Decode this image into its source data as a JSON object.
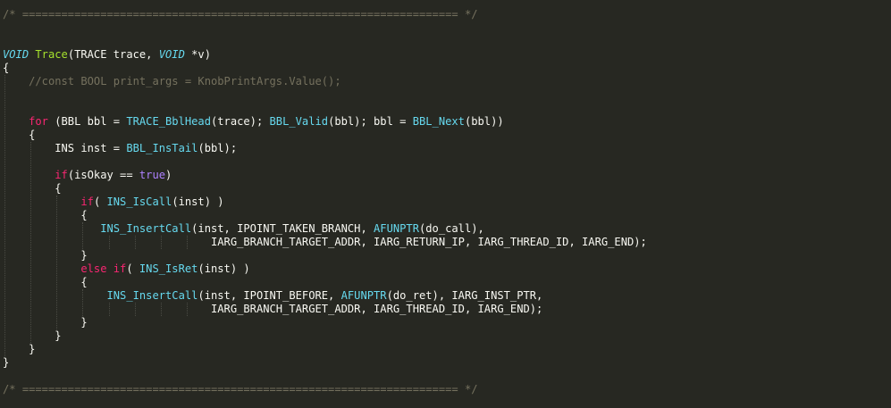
{
  "lines": [
    {
      "row": 0,
      "tokens": [
        {
          "t": "/* =================================================================== */",
          "c": "comment"
        }
      ]
    },
    {
      "row": 3,
      "tokens": [
        {
          "t": "VOID",
          "c": "type"
        },
        {
          "t": " ",
          "c": "plain"
        },
        {
          "t": "Trace",
          "c": "func"
        },
        {
          "t": "(TRACE trace, ",
          "c": "plain"
        },
        {
          "t": "VOID",
          "c": "type"
        },
        {
          "t": " *v)",
          "c": "plain"
        }
      ]
    },
    {
      "row": 4,
      "tokens": [
        {
          "t": "{",
          "c": "plain"
        }
      ]
    },
    {
      "row": 5,
      "tokens": [
        {
          "t": "    //const BOOL print_args = KnobPrintArgs.Value();",
          "c": "comment"
        }
      ]
    },
    {
      "row": 8,
      "tokens": [
        {
          "t": "    ",
          "c": "plain"
        },
        {
          "t": "for",
          "c": "kw"
        },
        {
          "t": " (BBL bbl = ",
          "c": "plain"
        },
        {
          "t": "TRACE_BblHead",
          "c": "api"
        },
        {
          "t": "(trace); ",
          "c": "plain"
        },
        {
          "t": "BBL_Valid",
          "c": "api"
        },
        {
          "t": "(bbl); bbl = ",
          "c": "plain"
        },
        {
          "t": "BBL_Next",
          "c": "api"
        },
        {
          "t": "(bbl))",
          "c": "plain"
        }
      ]
    },
    {
      "row": 9,
      "tokens": [
        {
          "t": "    {",
          "c": "plain"
        }
      ]
    },
    {
      "row": 10,
      "tokens": [
        {
          "t": "        INS inst = ",
          "c": "plain"
        },
        {
          "t": "BBL_InsTail",
          "c": "api"
        },
        {
          "t": "(bbl);",
          "c": "plain"
        }
      ]
    },
    {
      "row": 12,
      "tokens": [
        {
          "t": "        ",
          "c": "plain"
        },
        {
          "t": "if",
          "c": "kw"
        },
        {
          "t": "(isOkay == ",
          "c": "plain"
        },
        {
          "t": "true",
          "c": "const"
        },
        {
          "t": ")",
          "c": "plain"
        }
      ]
    },
    {
      "row": 13,
      "tokens": [
        {
          "t": "        {",
          "c": "plain"
        }
      ]
    },
    {
      "row": 14,
      "tokens": [
        {
          "t": "            ",
          "c": "plain"
        },
        {
          "t": "if",
          "c": "kw"
        },
        {
          "t": "( ",
          "c": "plain"
        },
        {
          "t": "INS_IsCall",
          "c": "api"
        },
        {
          "t": "(inst) )",
          "c": "plain"
        }
      ]
    },
    {
      "row": 15,
      "tokens": [
        {
          "t": "            {",
          "c": "plain"
        }
      ]
    },
    {
      "row": 16,
      "tokens": [
        {
          "t": "               ",
          "c": "plain"
        },
        {
          "t": "INS_InsertCall",
          "c": "api"
        },
        {
          "t": "(inst, IPOINT_TAKEN_BRANCH, ",
          "c": "plain"
        },
        {
          "t": "AFUNPTR",
          "c": "api"
        },
        {
          "t": "(do_call),",
          "c": "plain"
        }
      ]
    },
    {
      "row": 17,
      "tokens": [
        {
          "t": "                                IARG_BRANCH_TARGET_ADDR, IARG_RETURN_IP, IARG_THREAD_ID, IARG_END);",
          "c": "plain"
        }
      ]
    },
    {
      "row": 18,
      "tokens": [
        {
          "t": "            }",
          "c": "plain"
        }
      ]
    },
    {
      "row": 19,
      "tokens": [
        {
          "t": "            ",
          "c": "plain"
        },
        {
          "t": "else",
          "c": "kw"
        },
        {
          "t": " ",
          "c": "plain"
        },
        {
          "t": "if",
          "c": "kw"
        },
        {
          "t": "( ",
          "c": "plain"
        },
        {
          "t": "INS_IsRet",
          "c": "api"
        },
        {
          "t": "(inst) )",
          "c": "plain"
        }
      ]
    },
    {
      "row": 20,
      "tokens": [
        {
          "t": "            {",
          "c": "plain"
        }
      ]
    },
    {
      "row": 21,
      "tokens": [
        {
          "t": "                ",
          "c": "plain"
        },
        {
          "t": "INS_InsertCall",
          "c": "api"
        },
        {
          "t": "(inst, IPOINT_BEFORE, ",
          "c": "plain"
        },
        {
          "t": "AFUNPTR",
          "c": "api"
        },
        {
          "t": "(do_ret), IARG_INST_PTR,",
          "c": "plain"
        }
      ]
    },
    {
      "row": 22,
      "tokens": [
        {
          "t": "                                IARG_BRANCH_TARGET_ADDR, IARG_THREAD_ID, IARG_END);",
          "c": "plain"
        }
      ]
    },
    {
      "row": 23,
      "tokens": [
        {
          "t": "            }",
          "c": "plain"
        }
      ]
    },
    {
      "row": 24,
      "tokens": [
        {
          "t": "        }",
          "c": "plain"
        }
      ]
    },
    {
      "row": 25,
      "tokens": [
        {
          "t": "    }",
          "c": "plain"
        }
      ]
    },
    {
      "row": 26,
      "tokens": [
        {
          "t": "}",
          "c": "plain"
        }
      ]
    },
    {
      "row": 28,
      "tokens": [
        {
          "t": "/* =================================================================== */",
          "c": "comment"
        }
      ]
    }
  ],
  "indent_guides": [
    {
      "col": 0,
      "from_row": 5,
      "to_row": 25
    },
    {
      "col": 4,
      "from_row": 10,
      "to_row": 24
    },
    {
      "col": 8,
      "from_row": 14,
      "to_row": 23
    },
    {
      "col": 12,
      "from_row": 16,
      "to_row": 17
    },
    {
      "col": 12,
      "from_row": 21,
      "to_row": 22
    },
    {
      "col": 16,
      "from_row": 17,
      "to_row": 17
    },
    {
      "col": 16,
      "from_row": 22,
      "to_row": 22
    },
    {
      "col": 20,
      "from_row": 17,
      "to_row": 17
    },
    {
      "col": 20,
      "from_row": 22,
      "to_row": 22
    },
    {
      "col": 24,
      "from_row": 17,
      "to_row": 17
    },
    {
      "col": 24,
      "from_row": 22,
      "to_row": 22
    },
    {
      "col": 28,
      "from_row": 17,
      "to_row": 17
    },
    {
      "col": 28,
      "from_row": 22,
      "to_row": 22
    }
  ],
  "theme": {
    "background": "#272822",
    "comment": "#75715e",
    "keyword": "#f92672",
    "function": "#a6e22e",
    "api": "#66d9ef",
    "constant": "#ae81ff",
    "text": "#f8f8f2"
  }
}
